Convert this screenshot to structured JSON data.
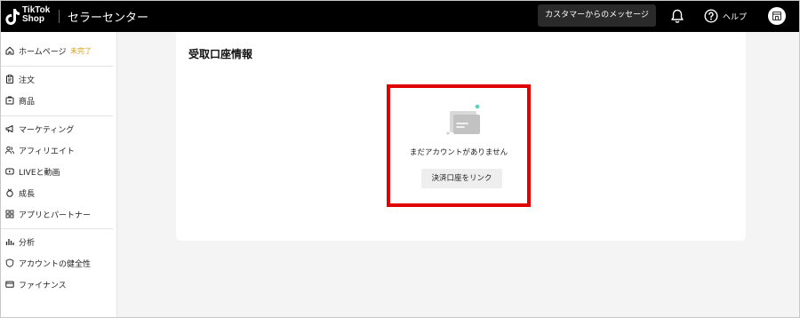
{
  "header": {
    "logo_line1": "TikTok",
    "logo_line2": "Shop",
    "app_title": "セラーセンター",
    "message_button": "カスタマーからのメッセージ",
    "help_label": "ヘルプ"
  },
  "sidebar": {
    "items": [
      {
        "label": "ホームページ",
        "icon": "home-icon",
        "badge": "未完了"
      },
      {
        "label": "注文",
        "icon": "clipboard-icon"
      },
      {
        "label": "商品",
        "icon": "product-box-icon"
      },
      {
        "label": "マーケティング",
        "icon": "megaphone-icon"
      },
      {
        "label": "アフィリエイト",
        "icon": "affiliate-users-icon"
      },
      {
        "label": "LIVEと動画",
        "icon": "live-video-icon"
      },
      {
        "label": "成長",
        "icon": "growth-medal-icon"
      },
      {
        "label": "アプリとパートナー",
        "icon": "apps-grid-icon"
      },
      {
        "label": "分析",
        "icon": "bar-chart-icon"
      },
      {
        "label": "アカウントの健全性",
        "icon": "health-shield-icon"
      },
      {
        "label": "ファイナンス",
        "icon": "finance-card-icon"
      }
    ]
  },
  "main": {
    "card_title": "受取口座情報",
    "empty_message": "まだアカウントがありません",
    "link_button": "決済口座をリンク"
  },
  "colors": {
    "topbar": "#000000",
    "highlight": "#e00000",
    "badge": "#d4a017",
    "accent_dot": "#5ad1b8"
  }
}
